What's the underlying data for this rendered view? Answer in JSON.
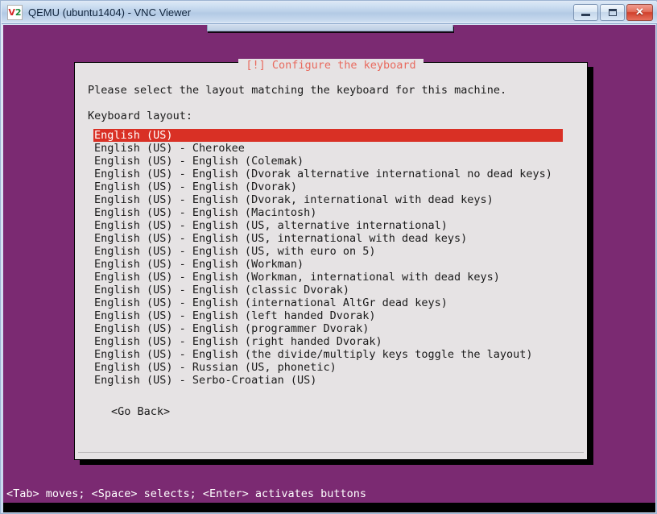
{
  "window": {
    "title": "QEMU (ubuntu1404) - VNC Viewer",
    "icon_name": "vnc-viewer-icon",
    "icon_text_v": "V",
    "icon_text_2": "2",
    "buttons": {
      "minimize_label": "Minimize",
      "maximize_label": "Maximize",
      "close_label": "✕"
    }
  },
  "colors": {
    "desktop_purple": "#7b2a72",
    "dialog_bg": "#e6e3e4",
    "selection_red": "#d93025",
    "title_salmon": "#e86a5e",
    "titlebar_blue": "#b9cfe8"
  },
  "dialog": {
    "title": "[!] Configure the keyboard",
    "prompt": "Please select the layout matching the keyboard for this machine.",
    "field_label": "Keyboard layout:",
    "selected_index": 0,
    "items": [
      "English (US)",
      "English (US) - Cherokee",
      "English (US) - English (Colemak)",
      "English (US) - English (Dvorak alternative international no dead keys)",
      "English (US) - English (Dvorak)",
      "English (US) - English (Dvorak, international with dead keys)",
      "English (US) - English (Macintosh)",
      "English (US) - English (US, alternative international)",
      "English (US) - English (US, international with dead keys)",
      "English (US) - English (US, with euro on 5)",
      "English (US) - English (Workman)",
      "English (US) - English (Workman, international with dead keys)",
      "English (US) - English (classic Dvorak)",
      "English (US) - English (international AltGr dead keys)",
      "English (US) - English (left handed Dvorak)",
      "English (US) - English (programmer Dvorak)",
      "English (US) - English (right handed Dvorak)",
      "English (US) - English (the divide/multiply keys toggle the layout)",
      "English (US) - Russian (US, phonetic)",
      "English (US) - Serbo-Croatian (US)"
    ],
    "go_back_button": "<Go Back>"
  },
  "status_bar": {
    "help_text": "<Tab> moves; <Space> selects; <Enter> activates buttons"
  }
}
